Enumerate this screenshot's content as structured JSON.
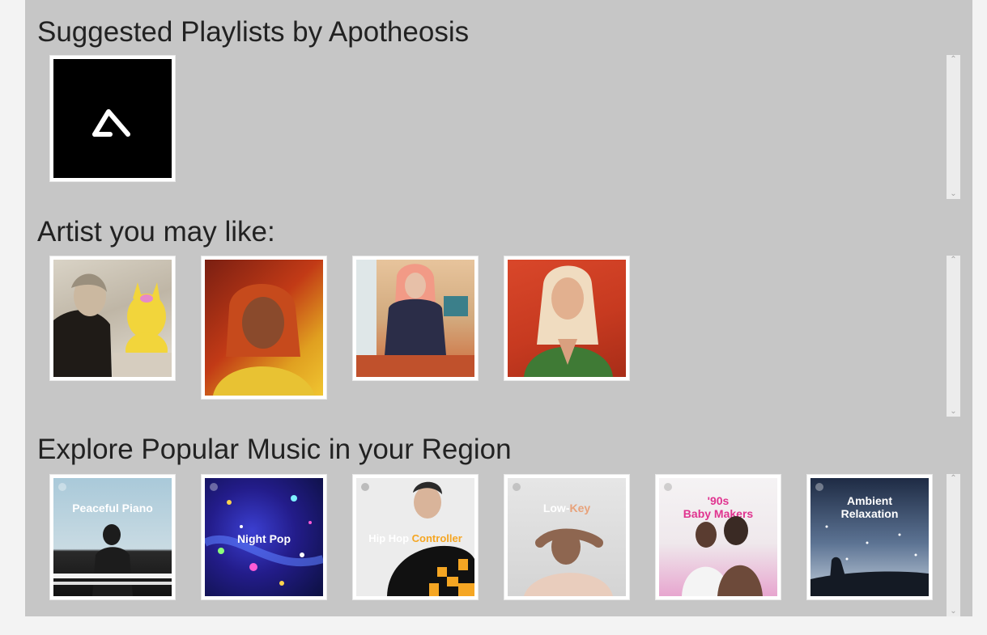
{
  "sections": {
    "playlists": {
      "title": "Suggested Playlists by Apotheosis"
    },
    "artists": {
      "title": "Artist you may like:"
    },
    "explore": {
      "title": "Explore Popular Music in your Region",
      "covers": [
        {
          "lines": [
            "Peaceful Piano"
          ]
        },
        {
          "lines": [
            "Night Pop"
          ]
        },
        {
          "parts": [
            "Hip Hop ",
            "Controller"
          ]
        },
        {
          "parts": [
            "Low-",
            "Key"
          ]
        },
        {
          "lines": [
            "'90s",
            "Baby Makers"
          ]
        },
        {
          "lines": [
            "Ambient",
            "Relaxation"
          ]
        }
      ]
    }
  },
  "scrollbar": {
    "up_arrow": "^",
    "down_arrow": "v"
  },
  "colors": {
    "panel": "#c6c6c6",
    "page": "#f3f3f3",
    "controller_accent": "#f5a623",
    "lowkey_accent": "#e8a27a",
    "babymakers_pink": "#e0338f"
  }
}
